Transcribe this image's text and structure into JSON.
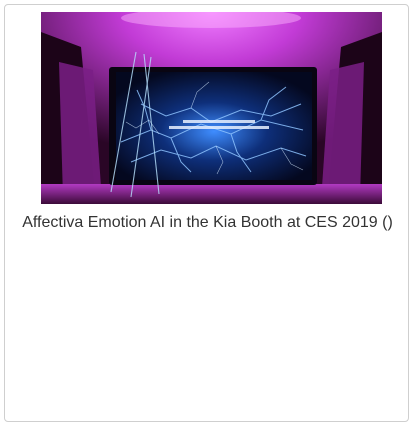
{
  "image": {
    "alt": "Affectiva Emotion AI in the Kia Booth at CES 2019"
  },
  "caption": "Affectiva Emotion AI in the Kia Booth at CES 2019 ()",
  "colors": {
    "border": "#cfcfcf",
    "caption_text": "#333333",
    "booth_magenta": "#c23bd6",
    "screen_blue": "#2f7fff"
  }
}
